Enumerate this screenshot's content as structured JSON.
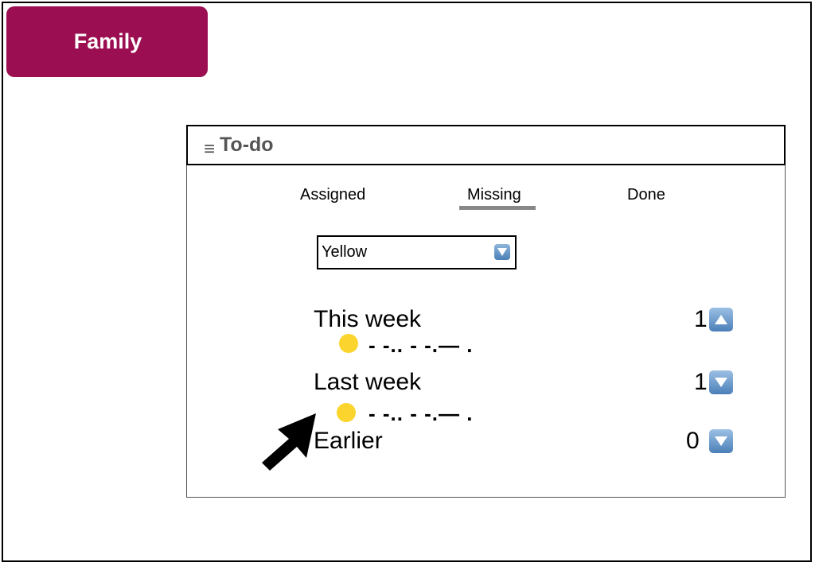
{
  "family_button": {
    "label": "Family"
  },
  "todo": {
    "menu_icon": "hamburger-icon",
    "title": "To-do",
    "tabs": [
      {
        "label": "Assigned",
        "selected": false
      },
      {
        "label": "Missing",
        "selected": true
      },
      {
        "label": "Done",
        "selected": false
      }
    ],
    "filter": {
      "value": "Yellow",
      "icon": "dropdown-arrow-icon"
    },
    "groups": [
      {
        "label": "This week",
        "count": "1",
        "toggle_icon": "chevron-up-icon",
        "expanded": true,
        "item_text": "- -.. - -.— ."
      },
      {
        "label": "Last week",
        "count": "1",
        "toggle_icon": "chevron-down-icon",
        "expanded": true,
        "item_text": "- -.. - -.— ."
      },
      {
        "label": "Earlier",
        "count": "0",
        "toggle_icon": "chevron-down-icon",
        "expanded": false
      }
    ]
  },
  "colors": {
    "family_button": "#9b0f52",
    "dot": "#fbd52e",
    "tab_underline": "#888888"
  },
  "cursor_icon": "mouse-pointer-icon"
}
